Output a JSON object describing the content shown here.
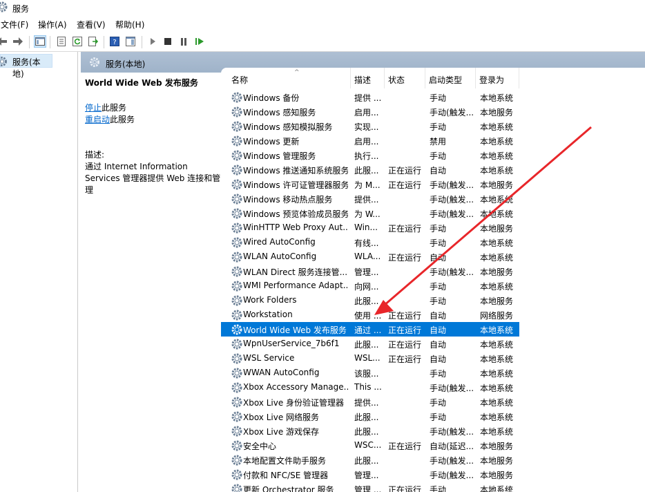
{
  "window": {
    "title": "服务"
  },
  "menu": [
    "文件(F)",
    "操作(A)",
    "查看(V)",
    "帮助(H)"
  ],
  "tree": {
    "item": "服务(本地)"
  },
  "header": {
    "title": "服务(本地)"
  },
  "desc": {
    "title": "World Wide Web 发布服务",
    "stop_link": "停止",
    "stop_suffix": "此服务",
    "restart_link": "重启动",
    "restart_suffix": "此服务",
    "desc_label": "描述:",
    "desc_text": "通过 Internet Information Services 管理器提供 Web 连接和管理"
  },
  "columns": {
    "name": "名称",
    "desc": "描述",
    "status": "状态",
    "startup": "启动类型",
    "logon": "登录为"
  },
  "rows": [
    {
      "name": "Windows 备份",
      "desc": "提供 ...",
      "status": "",
      "startup": "手动",
      "logon": "本地系统"
    },
    {
      "name": "Windows 感知服务",
      "desc": "启用...",
      "status": "",
      "startup": "手动(触发...",
      "logon": "本地服务"
    },
    {
      "name": "Windows 感知模拟服务",
      "desc": "实现...",
      "status": "",
      "startup": "手动",
      "logon": "本地系统"
    },
    {
      "name": "Windows 更新",
      "desc": "启用...",
      "status": "",
      "startup": "禁用",
      "logon": "本地系统"
    },
    {
      "name": "Windows 管理服务",
      "desc": "执行...",
      "status": "",
      "startup": "手动",
      "logon": "本地系统"
    },
    {
      "name": "Windows 推送通知系统服务",
      "desc": "此服...",
      "status": "正在运行",
      "startup": "自动",
      "logon": "本地系统"
    },
    {
      "name": "Windows 许可证管理器服务",
      "desc": "为 M...",
      "status": "正在运行",
      "startup": "手动(触发...",
      "logon": "本地服务"
    },
    {
      "name": "Windows 移动热点服务",
      "desc": "提供...",
      "status": "",
      "startup": "手动(触发...",
      "logon": "本地系统"
    },
    {
      "name": "Windows 预览体验成员服务",
      "desc": "为 W...",
      "status": "",
      "startup": "手动(触发...",
      "logon": "本地系统"
    },
    {
      "name": "WinHTTP Web Proxy Aut...",
      "desc": "Win...",
      "status": "正在运行",
      "startup": "手动",
      "logon": "本地服务"
    },
    {
      "name": "Wired AutoConfig",
      "desc": "有线...",
      "status": "",
      "startup": "手动",
      "logon": "本地系统"
    },
    {
      "name": "WLAN AutoConfig",
      "desc": "WLA...",
      "status": "正在运行",
      "startup": "自动",
      "logon": "本地系统"
    },
    {
      "name": "WLAN Direct 服务连接管...",
      "desc": "管理...",
      "status": "",
      "startup": "手动(触发...",
      "logon": "本地服务"
    },
    {
      "name": "WMI Performance Adapt...",
      "desc": "向网...",
      "status": "",
      "startup": "手动",
      "logon": "本地系统"
    },
    {
      "name": "Work Folders",
      "desc": "此服...",
      "status": "",
      "startup": "手动",
      "logon": "本地服务"
    },
    {
      "name": "Workstation",
      "desc": "使用 ...",
      "status": "正在运行",
      "startup": "自动",
      "logon": "网络服务"
    },
    {
      "name": "World Wide Web 发布服务",
      "desc": "通过 ...",
      "status": "正在运行",
      "startup": "自动",
      "logon": "本地系统",
      "selected": true
    },
    {
      "name": "WpnUserService_7b6f1",
      "desc": "此服...",
      "status": "正在运行",
      "startup": "自动",
      "logon": "本地系统"
    },
    {
      "name": "WSL Service",
      "desc": "WSL...",
      "status": "正在运行",
      "startup": "自动",
      "logon": "本地系统"
    },
    {
      "name": "WWAN AutoConfig",
      "desc": "该服...",
      "status": "",
      "startup": "手动",
      "logon": "本地系统"
    },
    {
      "name": "Xbox Accessory Manage...",
      "desc": "This ...",
      "status": "",
      "startup": "手动(触发...",
      "logon": "本地系统"
    },
    {
      "name": "Xbox Live 身份验证管理器",
      "desc": "提供...",
      "status": "",
      "startup": "手动",
      "logon": "本地系统"
    },
    {
      "name": "Xbox Live 网络服务",
      "desc": "此服...",
      "status": "",
      "startup": "手动",
      "logon": "本地系统"
    },
    {
      "name": "Xbox Live 游戏保存",
      "desc": "此服...",
      "status": "",
      "startup": "手动(触发...",
      "logon": "本地系统"
    },
    {
      "name": "安全中心",
      "desc": "WSC...",
      "status": "正在运行",
      "startup": "自动(延迟...",
      "logon": "本地服务"
    },
    {
      "name": "本地配置文件助手服务",
      "desc": "此服...",
      "status": "",
      "startup": "手动(触发...",
      "logon": "本地服务"
    },
    {
      "name": "付款和 NFC/SE 管理器",
      "desc": "管理...",
      "status": "",
      "startup": "手动(触发...",
      "logon": "本地服务"
    },
    {
      "name": "更新 Orchestrator 服务",
      "desc": "管理 ...",
      "status": "正在运行",
      "startup": "手动",
      "logon": "本地系统"
    }
  ],
  "annotation": {
    "color": "#e8262a"
  },
  "colors": {
    "selection": "#0078d7",
    "header": "#a9bbcf",
    "link": "#0066cc"
  }
}
